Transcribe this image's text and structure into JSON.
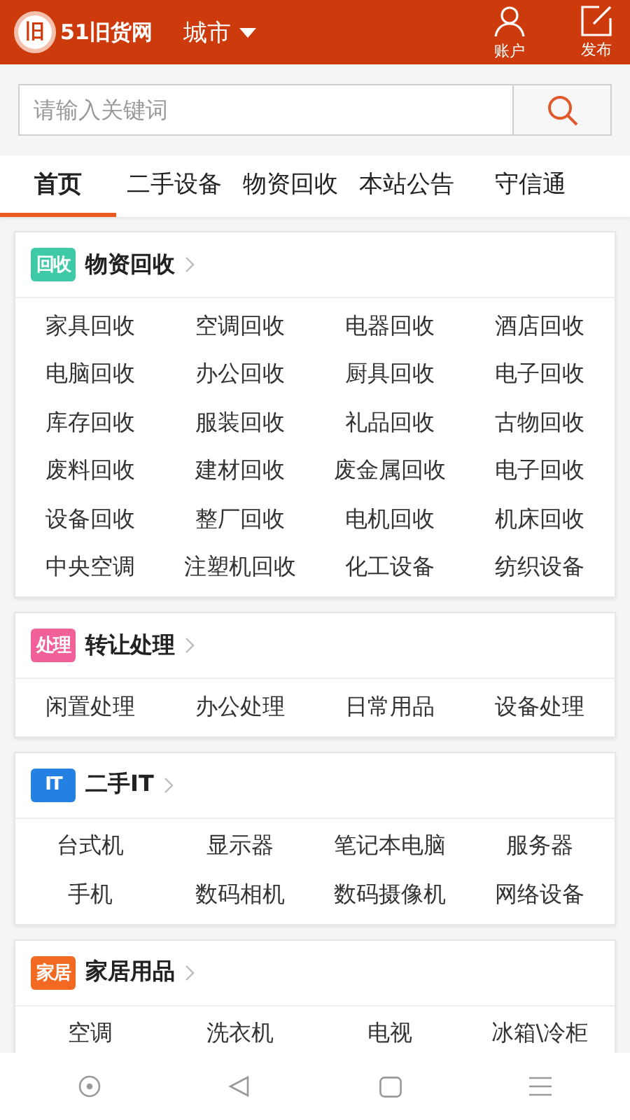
{
  "header": {
    "logo_mark": "旧",
    "logo_text": "51旧货网",
    "city": "城市",
    "actions": [
      {
        "kind": "account",
        "label": "账户"
      },
      {
        "kind": "publish",
        "label": "发布"
      }
    ]
  },
  "search": {
    "placeholder": "请输入关键词"
  },
  "tabs": [
    {
      "label": "首页",
      "selected": true
    },
    {
      "label": "二手设备",
      "selected": false
    },
    {
      "label": "物资回收",
      "selected": false
    },
    {
      "label": "本站公告",
      "selected": false
    },
    {
      "label": "守信通",
      "selected": false
    }
  ],
  "sections": [
    {
      "badge": "回收",
      "color": "#3ec9a7",
      "title": "物资回收",
      "items": [
        "家具回收",
        "空调回收",
        "电器回收",
        "酒店回收",
        "电脑回收",
        "办公回收",
        "厨具回收",
        "电子回收",
        "库存回收",
        "服装回收",
        "礼品回收",
        "古物回收",
        "废料回收",
        "建材回收",
        "废金属回收",
        "电子回收",
        "设备回收",
        "整厂回收",
        "电机回收",
        "机床回收",
        "中央空调",
        "注塑机回收",
        "化工设备",
        "纺织设备"
      ]
    },
    {
      "badge": "处理",
      "color": "#f2609a",
      "title": "转让处理",
      "items": [
        "闲置处理",
        "办公处理",
        "日常用品",
        "设备处理"
      ]
    },
    {
      "badge": "IT",
      "color": "#2481e3",
      "title": "二手IT",
      "items": [
        "台式机",
        "显示器",
        "笔记本电脑",
        "服务器",
        "手机",
        "数码相机",
        "数码摄像机",
        "网络设备"
      ]
    },
    {
      "badge": "家居",
      "color": "#f26a21",
      "title": "家居用品",
      "items": [
        "空调",
        "洗衣机",
        "电视",
        "冰箱\\冷柜"
      ]
    }
  ]
}
